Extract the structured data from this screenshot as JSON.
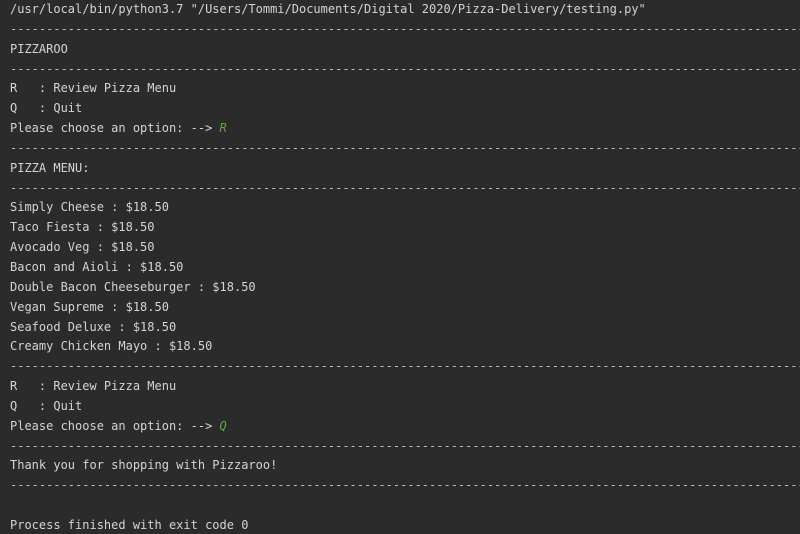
{
  "console": {
    "command": "/usr/local/bin/python3.7 \"/Users/Tommi/Documents/Digital 2020/Pizza-Delivery/testing.py\"",
    "separator": "------------------------------------------------------------------------------------------------------------------",
    "header": "PIZZAROO",
    "menu_option_review": "R   : Review Pizza Menu",
    "menu_option_quit": "Q   : Quit",
    "prompt": "Please choose an option: --> ",
    "input_1": "R",
    "pizza_menu_title": "PIZZA MENU:",
    "pizzas": [
      "Simply Cheese : $18.50",
      "Taco Fiesta : $18.50",
      "Avocado Veg : $18.50",
      "Bacon and Aioli : $18.50",
      "Double Bacon Cheeseburger : $18.50",
      "Vegan Supreme : $18.50",
      "Seafood Deluxe : $18.50",
      "Creamy Chicken Mayo : $18.50"
    ],
    "input_2": "Q",
    "thank_you": "Thank you for shopping with Pizzaroo!",
    "exit_message": "Process finished with exit code 0"
  },
  "colors": {
    "background": "#2b2b2b",
    "text": "#d4d4d4",
    "user_input": "#5da842"
  }
}
